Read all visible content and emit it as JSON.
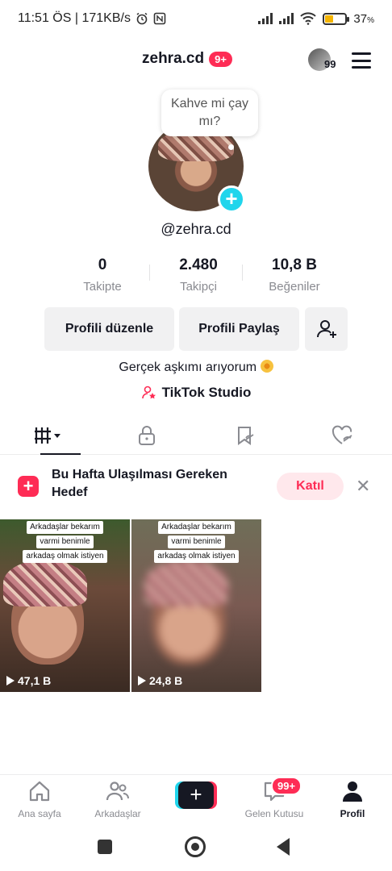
{
  "status_bar": {
    "time": "11:51 ÖS | 171KB/s",
    "battery": "37",
    "battery_unit": "%"
  },
  "header": {
    "username": "zehra.cd",
    "notif_badge": "9+",
    "account_count": "99"
  },
  "profile": {
    "bubble_text": "Kahve mi çay mı?",
    "handle": "@zehra.cd",
    "stats": [
      {
        "value": "0",
        "label": "Takipte"
      },
      {
        "value": "2.480",
        "label": "Takipçi"
      },
      {
        "value": "10,8 B",
        "label": "Beğeniler"
      }
    ],
    "edit_button": "Profili düzenle",
    "share_button": "Profili Paylaş",
    "bio": "Gerçek aşkımı arıyorum",
    "studio_link": "TikTok Studio"
  },
  "goal": {
    "text": "Bu Hafta Ulaşılması Gereken Hedef",
    "join_button": "Katıl"
  },
  "videos": [
    {
      "caption_lines": [
        "Arkadaşlar bekarım",
        "varmi benimle",
        "arkadaş olmak istiyen"
      ],
      "views": "47,1 B"
    },
    {
      "caption_lines": [
        "Arkadaşlar bekarım",
        "varmi benimle",
        "arkadaş olmak istiyen"
      ],
      "views": "24,8 B"
    }
  ],
  "bottom_nav": {
    "home": "Ana sayfa",
    "friends": "Arkadaşlar",
    "inbox": "Gelen Kutusu",
    "inbox_badge": "99+",
    "profile": "Profil"
  },
  "colors": {
    "accent": "#fe2c55",
    "cyan": "#20d5ec",
    "text": "#161823",
    "muted": "#8a8b91"
  }
}
